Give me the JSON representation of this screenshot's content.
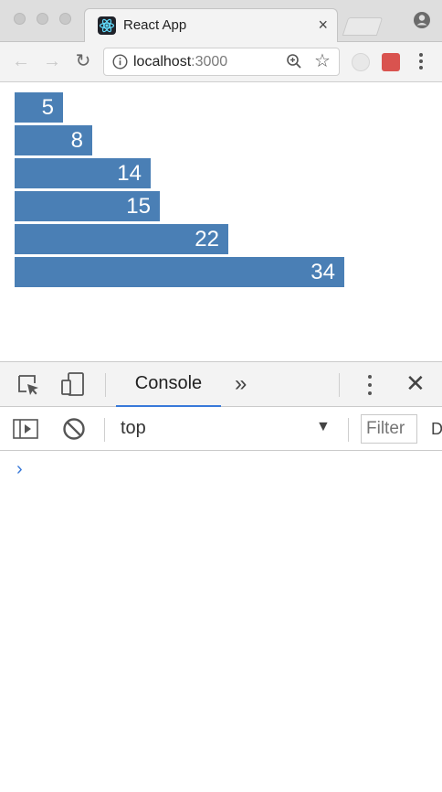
{
  "browser": {
    "tab": {
      "title": "React App",
      "close_glyph": "×"
    },
    "toolbar": {
      "url_host": "localhost",
      "url_port": ":3000",
      "back_glyph": "←",
      "forward_glyph": "→",
      "reload_glyph": "↻",
      "star_glyph": "☆"
    }
  },
  "page": {
    "bar_color": "#4a7fb5",
    "bars": [
      {
        "label": "5",
        "value": 5
      },
      {
        "label": "8",
        "value": 8
      },
      {
        "label": "14",
        "value": 14
      },
      {
        "label": "15",
        "value": 15
      },
      {
        "label": "22",
        "value": 22
      },
      {
        "label": "34",
        "value": 34
      }
    ]
  },
  "devtools": {
    "tabs": {
      "console": "Console",
      "overflow": "»"
    },
    "close_glyph": "✕",
    "toolbar": {
      "context": "top",
      "context_arrow": "▼",
      "filter_placeholder": "Filter",
      "levels_edge": "D"
    },
    "console": {
      "prompt_glyph": "›"
    },
    "accent_color": "#3879d9"
  }
}
